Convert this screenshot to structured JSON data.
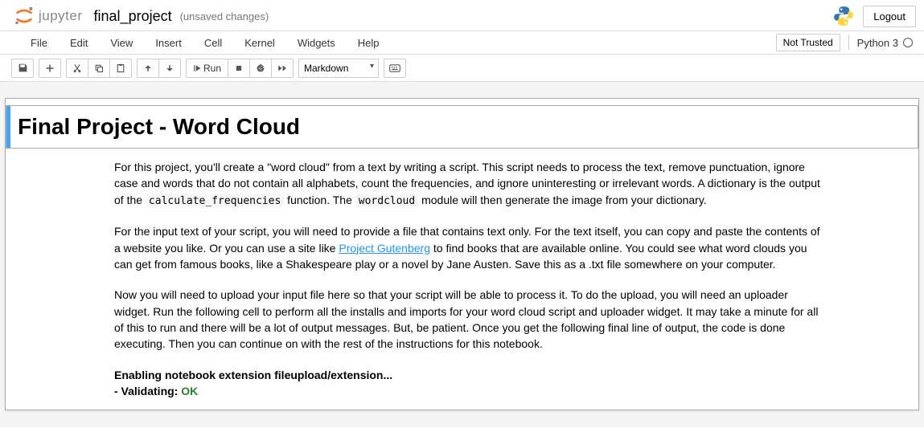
{
  "header": {
    "logo_text": "jupyter",
    "notebook_name": "final_project",
    "save_status": "(unsaved changes)",
    "logout": "Logout"
  },
  "menubar": {
    "items": [
      "File",
      "Edit",
      "View",
      "Insert",
      "Cell",
      "Kernel",
      "Widgets",
      "Help"
    ],
    "trust": "Not Trusted",
    "kernel": "Python 3"
  },
  "toolbar": {
    "run_label": "Run",
    "cell_type": "Markdown"
  },
  "content": {
    "title": "Final Project - Word Cloud",
    "p1_a": "For this project, you'll create a \"word cloud\" from a text by writing a script. This script needs to process the text, remove punctuation, ignore case and words that do not contain all alphabets, count the frequencies, and ignore uninteresting or irrelevant words. A dictionary is the output of the ",
    "code1": "calculate_frequencies",
    "p1_b": " function. The ",
    "code2": "wordcloud",
    "p1_c": " module will then generate the image from your dictionary.",
    "p2_a": "For the input text of your script, you will need to provide a file that contains text only. For the text itself, you can copy and paste the contents of a website you like. Or you can use a site like ",
    "link1": "Project Gutenberg",
    "p2_b": " to find books that are available online. You could see what word clouds you can get from famous books, like a Shakespeare play or a novel by Jane Austen. Save this as a .txt file somewhere on your computer.",
    "p3": "Now you will need to upload your input file here so that your script will be able to process it. To do the upload, you will need an uploader widget. Run the following cell to perform all the installs and imports for your word cloud script and uploader widget. It may take a minute for all of this to run and there will be a lot of output messages. But, be patient. Once you get the following final line of output, the code is done executing. Then you can continue on with the rest of the instructions for this notebook.",
    "p4_a": "Enabling notebook extension fileupload/extension...",
    "p4_b": "- Validating: ",
    "p4_ok": "OK"
  }
}
